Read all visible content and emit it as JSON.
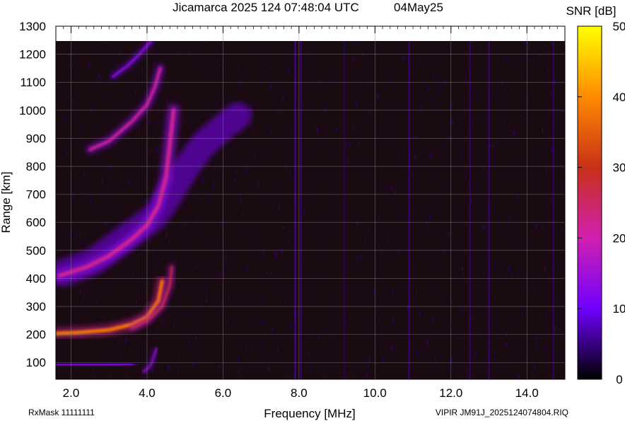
{
  "chart_data": {
    "type": "heatmap",
    "title": "Jicamarca 2025 124 07:48:04 UTC",
    "date": "04May25",
    "xlabel": "Frequency [MHz]",
    "ylabel": "Range [km]",
    "xlim": [
      1.6,
      15.0
    ],
    "ylim": [
      40,
      1300
    ],
    "data_ymax": 1245,
    "x_ticks": [
      "2.0",
      "4.0",
      "6.0",
      "8.0",
      "10.0",
      "12.0",
      "14.0"
    ],
    "x_tick_values": [
      2.0,
      4.0,
      6.0,
      8.0,
      10.0,
      12.0,
      14.0
    ],
    "y_ticks": [
      "100",
      "200",
      "300",
      "400",
      "500",
      "600",
      "700",
      "800",
      "900",
      "1000",
      "1100",
      "1200",
      "1300"
    ],
    "y_tick_values": [
      100,
      200,
      300,
      400,
      500,
      600,
      700,
      800,
      900,
      1000,
      1100,
      1200,
      1300
    ],
    "colorbar": {
      "label": "SNR [dB]",
      "range": [
        0,
        50
      ],
      "ticks": [
        "0",
        "10",
        "20",
        "30",
        "40",
        "50"
      ],
      "tick_values": [
        0,
        10,
        20,
        30,
        40,
        50
      ]
    },
    "traces": [
      {
        "name": "F-layer O trace",
        "points": [
          [
            1.6,
            203
          ],
          [
            2.2,
            207
          ],
          [
            3.0,
            216
          ],
          [
            3.6,
            236
          ],
          [
            4.0,
            262
          ],
          [
            4.3,
            320
          ],
          [
            4.4,
            390
          ]
        ],
        "snr": 38,
        "width": 5
      },
      {
        "name": "F-layer X trace",
        "points": [
          [
            3.6,
            222
          ],
          [
            4.0,
            250
          ],
          [
            4.4,
            300
          ],
          [
            4.6,
            375
          ],
          [
            4.65,
            440
          ]
        ],
        "snr": 28,
        "width": 3
      },
      {
        "name": "E-layer echo",
        "points": [
          [
            1.6,
            90
          ],
          [
            2.6,
            92
          ],
          [
            3.6,
            95
          ]
        ],
        "snr": 12,
        "width": 5
      },
      {
        "name": "Low-range spur",
        "points": [
          [
            3.9,
            65
          ],
          [
            4.1,
            90
          ],
          [
            4.25,
            150
          ]
        ],
        "snr": 16,
        "width": 2
      },
      {
        "name": "Second hop",
        "points": [
          [
            1.7,
            410
          ],
          [
            2.4,
            440
          ],
          [
            3.0,
            480
          ],
          [
            3.6,
            540
          ],
          [
            4.0,
            590
          ],
          [
            4.3,
            660
          ],
          [
            4.5,
            760
          ],
          [
            4.6,
            880
          ],
          [
            4.7,
            1000
          ]
        ],
        "snr": 22,
        "width": 6
      },
      {
        "name": "Third hop",
        "points": [
          [
            2.5,
            860
          ],
          [
            3.0,
            890
          ],
          [
            3.6,
            960
          ],
          [
            4.0,
            1020
          ],
          [
            4.2,
            1080
          ],
          [
            4.35,
            1150
          ]
        ],
        "snr": 22,
        "width": 4
      },
      {
        "name": "Fourth hop",
        "points": [
          [
            3.1,
            1120
          ],
          [
            3.5,
            1160
          ],
          [
            3.8,
            1200
          ],
          [
            4.1,
            1245
          ]
        ],
        "snr": 14,
        "width": 3
      }
    ],
    "spread_regions": [
      {
        "name": "Spread F",
        "points": [
          [
            1.8,
            420
          ],
          [
            2.6,
            460
          ],
          [
            3.4,
            540
          ],
          [
            4.2,
            620
          ],
          [
            4.6,
            700
          ],
          [
            5.0,
            790
          ],
          [
            5.5,
            880
          ],
          [
            6.0,
            940
          ],
          [
            6.4,
            980
          ]
        ],
        "snr": 11
      }
    ],
    "interference_lines": [
      {
        "freq": 7.9,
        "snr": 8
      },
      {
        "freq": 8.05,
        "snr": 6
      },
      {
        "freq": 9.2,
        "snr": 4
      },
      {
        "freq": 10.9,
        "snr": 6
      },
      {
        "freq": 12.5,
        "snr": 5
      },
      {
        "freq": 13.0,
        "snr": 6
      },
      {
        "freq": 14.7,
        "snr": 5
      }
    ]
  },
  "footer": {
    "left": "RxMask 11111111",
    "right": "VIPIR  JM91J_2025124074804.RIQ"
  }
}
